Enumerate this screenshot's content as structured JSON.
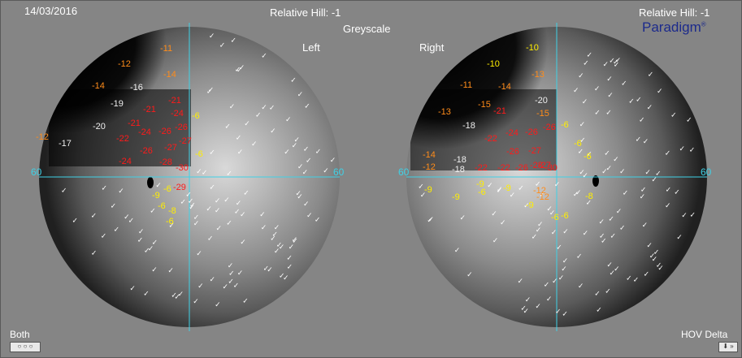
{
  "header": {
    "date": "14/03/2016",
    "left_hill": "Relative Hill: -1",
    "right_hill": "Relative Hill: -1",
    "mode": "Greyscale",
    "brand": "Paradigm",
    "brand_mark": "®"
  },
  "eyes": {
    "left_title": "Left",
    "right_title": "Right"
  },
  "axis": {
    "left_left": "60",
    "left_right": "60",
    "right_left": "60",
    "right_right": "60"
  },
  "footer": {
    "both": "Both",
    "hov": "HOV Delta",
    "lens_controls": "○ ○ ○",
    "step_controls": "⬇ »"
  },
  "colors": {
    "red": "#ff1a1a",
    "orange": "#ff8c1a",
    "yellow": "#ffee00",
    "white": "#eeeeee",
    "axis": "#3fd1e6"
  },
  "left_values": [
    {
      "t": "-11",
      "c": "orange"
    },
    {
      "t": "-12",
      "c": "orange"
    },
    {
      "t": "-14",
      "c": "orange"
    },
    {
      "t": "-16",
      "c": "white"
    },
    {
      "t": "-14",
      "c": "orange"
    },
    {
      "t": "-19",
      "c": "white"
    },
    {
      "t": "-21",
      "c": "red"
    },
    {
      "t": "-21",
      "c": "red"
    },
    {
      "t": "-24",
      "c": "red"
    },
    {
      "t": "-20",
      "c": "white"
    },
    {
      "t": "-21",
      "c": "red"
    },
    {
      "t": "-24",
      "c": "red"
    },
    {
      "t": "-26",
      "c": "red"
    },
    {
      "t": "-26",
      "c": "red"
    },
    {
      "t": "-6",
      "c": "yellow"
    },
    {
      "t": "-12",
      "c": "orange"
    },
    {
      "t": "-17",
      "c": "white"
    },
    {
      "t": "-22",
      "c": "red"
    },
    {
      "t": "-27",
      "c": "red"
    },
    {
      "t": "-26",
      "c": "red"
    },
    {
      "t": "-27",
      "c": "red"
    },
    {
      "t": "-6",
      "c": "yellow"
    },
    {
      "t": "-24",
      "c": "red"
    },
    {
      "t": "-28",
      "c": "red"
    },
    {
      "t": "-30",
      "c": "red"
    },
    {
      "t": "-29",
      "c": "red"
    },
    {
      "t": "-9",
      "c": "yellow"
    },
    {
      "t": "-6",
      "c": "yellow"
    },
    {
      "t": "-6",
      "c": "yellow"
    },
    {
      "t": "-8",
      "c": "yellow"
    },
    {
      "t": "-6",
      "c": "yellow"
    }
  ],
  "right_values": [
    {
      "t": "-10",
      "c": "yellow"
    },
    {
      "t": "-10",
      "c": "yellow"
    },
    {
      "t": "-13",
      "c": "orange"
    },
    {
      "t": "-11",
      "c": "orange"
    },
    {
      "t": "-14",
      "c": "orange"
    },
    {
      "t": "-13",
      "c": "orange"
    },
    {
      "t": "-15",
      "c": "orange"
    },
    {
      "t": "-20",
      "c": "white"
    },
    {
      "t": "-15",
      "c": "orange"
    },
    {
      "t": "-18",
      "c": "white"
    },
    {
      "t": "-21",
      "c": "red"
    },
    {
      "t": "-24",
      "c": "red"
    },
    {
      "t": "-26",
      "c": "red"
    },
    {
      "t": "-26",
      "c": "red"
    },
    {
      "t": "-6",
      "c": "yellow"
    },
    {
      "t": "-22",
      "c": "red"
    },
    {
      "t": "-14",
      "c": "orange"
    },
    {
      "t": "-18",
      "c": "white"
    },
    {
      "t": "-26",
      "c": "red"
    },
    {
      "t": "-27",
      "c": "red"
    },
    {
      "t": "-6",
      "c": "yellow"
    },
    {
      "t": "-6",
      "c": "yellow"
    },
    {
      "t": "-12",
      "c": "orange"
    },
    {
      "t": "-18",
      "c": "white"
    },
    {
      "t": "-22",
      "c": "red"
    },
    {
      "t": "-22",
      "c": "red"
    },
    {
      "t": "-26",
      "c": "red"
    },
    {
      "t": "-27",
      "c": "red"
    },
    {
      "t": "-28",
      "c": "red"
    },
    {
      "t": "-30",
      "c": "red"
    },
    {
      "t": "-9",
      "c": "yellow"
    },
    {
      "t": "-9",
      "c": "yellow"
    },
    {
      "t": "-9",
      "c": "yellow"
    },
    {
      "t": "-9",
      "c": "yellow"
    },
    {
      "t": "-12",
      "c": "orange"
    },
    {
      "t": "-12",
      "c": "orange"
    },
    {
      "t": "-6",
      "c": "yellow"
    },
    {
      "t": "-6",
      "c": "yellow"
    },
    {
      "t": "-9",
      "c": "yellow"
    },
    {
      "t": "-6",
      "c": "yellow"
    },
    {
      "t": "-8",
      "c": "yellow"
    }
  ]
}
